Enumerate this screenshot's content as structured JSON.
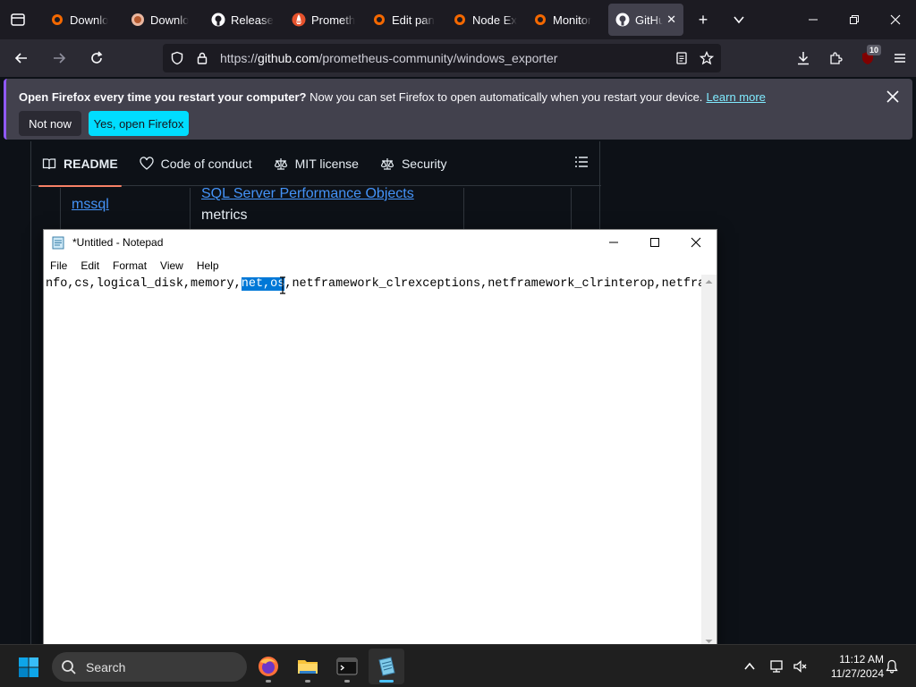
{
  "browser": {
    "tabs": [
      {
        "label": "Downlo",
        "icon": "grafana-icon"
      },
      {
        "label": "Downlo",
        "icon": "firefox-download-icon"
      },
      {
        "label": "Release",
        "icon": "github-icon"
      },
      {
        "label": "Prometh",
        "icon": "prometheus-icon"
      },
      {
        "label": "Edit pan",
        "icon": "grafana-icon"
      },
      {
        "label": "Node Ex",
        "icon": "grafana-icon"
      },
      {
        "label": "Monitor",
        "icon": "grafana-icon"
      },
      {
        "label": "GitHu",
        "icon": "github-icon",
        "active": true
      }
    ],
    "url_prefix": "https://",
    "url_host": "github.com",
    "url_path": "/prometheus-community/windows_exporter",
    "extensions_badge": "10"
  },
  "notification": {
    "bold": "Open Firefox every time you restart your computer?",
    "text": " Now you can set Firefox to open automatically when you restart your device.",
    "link": "Learn more",
    "btn_not_now": "Not now",
    "btn_yes": "Yes, open Firefox"
  },
  "github": {
    "tabs": [
      {
        "label": "README",
        "icon": "book-icon"
      },
      {
        "label": "Code of conduct",
        "icon": "heart-icon"
      },
      {
        "label": "MIT license",
        "icon": "scale-icon"
      },
      {
        "label": "Security",
        "icon": "scale-icon"
      }
    ],
    "table": {
      "row_name": "mssql",
      "row_link": "SQL Server Performance Objects",
      "row_desc": "metrics"
    }
  },
  "notepad": {
    "title": "*Untitled - Notepad",
    "menu": [
      "File",
      "Edit",
      "Format",
      "View",
      "Help"
    ],
    "text_before": "nfo,cs,logical_disk,memory,",
    "text_selected": "net,os",
    "text_after": ",netframework_clrexceptions,netframework_clrinterop,netfram"
  },
  "taskbar": {
    "search_label": "Search",
    "time": "11:12 AM",
    "date": "11/27/2024"
  }
}
